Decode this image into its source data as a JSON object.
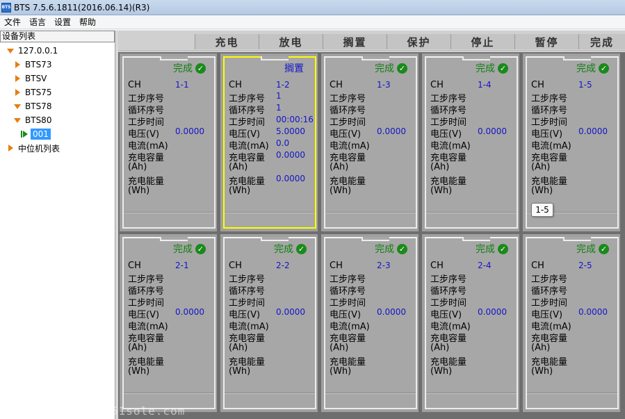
{
  "window": {
    "title": "BTS 7.5.6.1811(2016.06.14)(R3)",
    "icon_name": "bts-app-icon"
  },
  "menu": [
    "文件",
    "语言",
    "设置",
    "帮助"
  ],
  "tree": {
    "header": "设备列表",
    "nodes": [
      {
        "label": "127.0.0.1",
        "icon": "expanded-arrow-icon"
      },
      {
        "label": "BTS73",
        "icon": "collapsed-arrow-icon"
      },
      {
        "label": "BTSV",
        "icon": "collapsed-arrow-icon"
      },
      {
        "label": "BTS75",
        "icon": "collapsed-arrow-icon"
      },
      {
        "label": "BTS78",
        "icon": "expanded-arrow-icon"
      },
      {
        "label": "BTS80",
        "icon": "expanded-arrow-icon"
      },
      {
        "label": "001",
        "icon": "running-icon",
        "selected": true
      },
      {
        "label": "中位机列表",
        "icon": "collapsed-arrow-icon"
      }
    ]
  },
  "toolbar": [
    "充电",
    "放电",
    "搁置",
    "保护",
    "停止",
    "暂停",
    "完成"
  ],
  "field_labels": {
    "ch": "CH",
    "step_no": "工步序号",
    "cycle_no": "循环序号",
    "step_time": "工步时间",
    "voltage": "电压(V)",
    "current": "电流(mA)",
    "capacity": "充电容量",
    "capacity_unit": "(Ah)",
    "energy": "充电能量",
    "energy_unit": "(Wh)"
  },
  "channels": [
    {
      "ch": "1-1",
      "status": "完成",
      "status_type": "done",
      "step": "",
      "cycle": "",
      "time": "",
      "voltage": "0.0000",
      "current": "",
      "capacity": "",
      "energy": ""
    },
    {
      "ch": "1-2",
      "status": "搁置",
      "status_type": "rest",
      "step": "1",
      "cycle": "1",
      "time": "00:00:16",
      "voltage": "5.0000",
      "current": "0.0",
      "capacity": "0.0000",
      "energy": "0.0000",
      "selected": true
    },
    {
      "ch": "1-3",
      "status": "完成",
      "status_type": "done",
      "step": "",
      "cycle": "",
      "time": "",
      "voltage": "0.0000",
      "current": "",
      "capacity": "",
      "energy": ""
    },
    {
      "ch": "1-4",
      "status": "完成",
      "status_type": "done",
      "step": "",
      "cycle": "",
      "time": "",
      "voltage": "0.0000",
      "current": "",
      "capacity": "",
      "energy": ""
    },
    {
      "ch": "1-5",
      "status": "完成",
      "status_type": "done",
      "step": "",
      "cycle": "",
      "time": "",
      "voltage": "0.0000",
      "current": "",
      "capacity": "",
      "energy": ""
    },
    {
      "ch": "2-1",
      "status": "完成",
      "status_type": "done",
      "step": "",
      "cycle": "",
      "time": "",
      "voltage": "0.0000",
      "current": "",
      "capacity": "",
      "energy": ""
    },
    {
      "ch": "2-2",
      "status": "完成",
      "status_type": "done",
      "step": "",
      "cycle": "",
      "time": "",
      "voltage": "0.0000",
      "current": "",
      "capacity": "",
      "energy": ""
    },
    {
      "ch": "2-3",
      "status": "完成",
      "status_type": "done",
      "step": "",
      "cycle": "",
      "time": "",
      "voltage": "0.0000",
      "current": "",
      "capacity": "",
      "energy": ""
    },
    {
      "ch": "2-4",
      "status": "完成",
      "status_type": "done",
      "step": "",
      "cycle": "",
      "time": "",
      "voltage": "0.0000",
      "current": "",
      "capacity": "",
      "energy": ""
    },
    {
      "ch": "2-5",
      "status": "完成",
      "status_type": "done",
      "step": "",
      "cycle": "",
      "time": "",
      "voltage": "0.0000",
      "current": "",
      "capacity": "",
      "energy": ""
    }
  ],
  "tooltip": "1-5",
  "watermark": "51sole.com",
  "colors": {
    "done": "#108010",
    "rest": "#1414c8",
    "selected_border": "#ffff00",
    "value": "#1414c8"
  }
}
